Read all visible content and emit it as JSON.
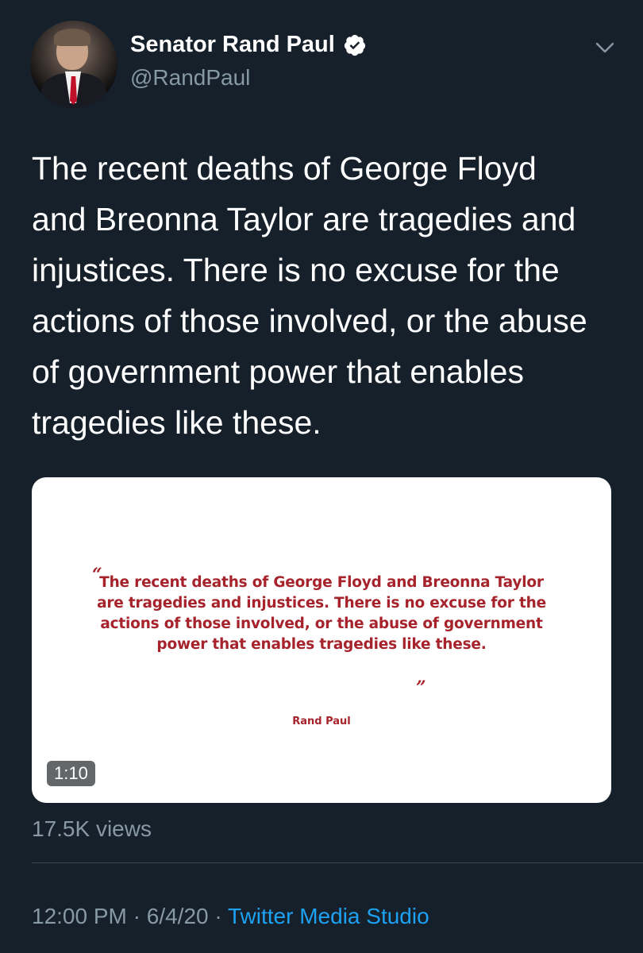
{
  "author": {
    "display_name": "Senator Rand Paul",
    "handle": "@RandPaul",
    "verified": true
  },
  "tweet": {
    "text": "The recent deaths of George Floyd\nand Breonna Taylor are tragedies and\ninjustices. There is no excuse for the\nactions of those involved, or the abuse\nof government power that enables\ntragedies like these."
  },
  "media": {
    "quote_open": "“",
    "quote_text": "The recent deaths of George Floyd and Breonna Taylor are tragedies and injustices. There is no excuse for the actions of those involved, or the abuse of government power that enables tragedies like these.",
    "quote_close": "”",
    "quote_author": "Rand Paul",
    "duration": "1:10",
    "quote_color": "#a6232c"
  },
  "stats": {
    "views": "17.5K views"
  },
  "meta": {
    "time": "12:00 PM",
    "separator1": " · ",
    "date": "6/4/20",
    "separator2": " · ",
    "source": "Twitter Media Studio"
  },
  "colors": {
    "background": "#15202b",
    "secondary_text": "#8899a6",
    "link": "#1da1f2",
    "verified_badge": "#ffffff"
  },
  "icons": {
    "verified": "verified-badge-icon",
    "menu": "chevron-down-icon"
  }
}
